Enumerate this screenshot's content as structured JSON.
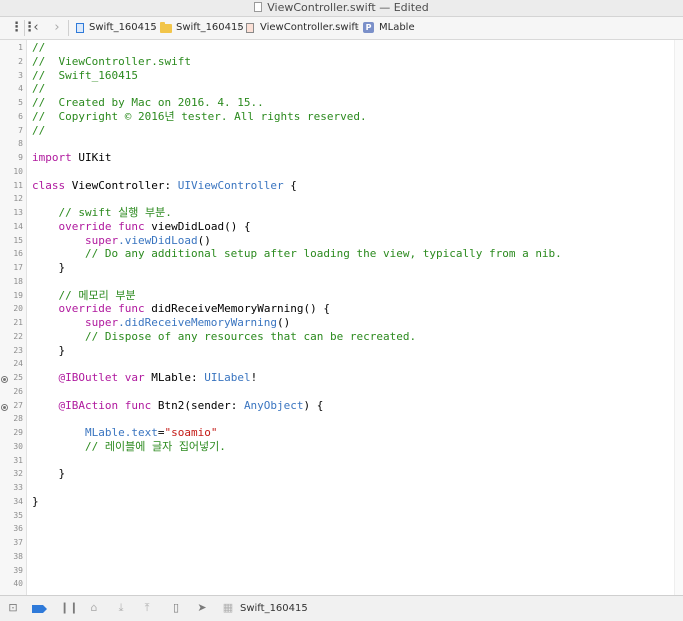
{
  "window": {
    "title": "ViewController.swift — Edited"
  },
  "jumpbar": {
    "crumbs": [
      "Swift_160415",
      "Swift_160415",
      "ViewController.swift",
      "MLable"
    ]
  },
  "gutter": {
    "line_numbers": [
      "1",
      "2",
      "3",
      "4",
      "5",
      "6",
      "7",
      "8",
      "9",
      "10",
      "11",
      "12",
      "13",
      "14",
      "15",
      "16",
      "17",
      "18",
      "19",
      "20",
      "21",
      "22",
      "23",
      "24",
      "25",
      "26",
      "27",
      "28",
      "29",
      "30",
      "31",
      "32",
      "33",
      "34",
      "35",
      "36",
      "37",
      "38",
      "39",
      "40"
    ],
    "outlet_lines": [
      "25",
      "27"
    ]
  },
  "code": {
    "l1": "//",
    "l2": "//  ViewController.swift",
    "l3": "//  Swift_160415",
    "l4": "//",
    "l5": "//  Created by Mac on 2016. 4. 15..",
    "l6": "//  Copyright © 2016년 tester. All rights reserved.",
    "l7": "//",
    "l9_kw": "import",
    "l9_rest": " UIKit",
    "l11_kw": "class",
    "l11_mid": " ViewController: ",
    "l11_type": "UIViewController",
    "l11_end": " {",
    "l13": "    // swift 실행 부분.",
    "l14_kw1": "    override",
    "l14_kw2": " func",
    "l14_rest": " viewDidLoad() {",
    "l15_kw": "        super",
    "l15_call": ".viewDidLoad",
    "l15_end": "()",
    "l16": "        // Do any additional setup after loading the view, typically from a nib.",
    "l17": "    }",
    "l19": "    // 메모리 부분",
    "l20_kw1": "    override",
    "l20_kw2": " func",
    "l20_rest": " didReceiveMemoryWarning() {",
    "l21_kw": "        super",
    "l21_call": ".didReceiveMemoryWarning",
    "l21_end": "()",
    "l22": "        // Dispose of any resources that can be recreated.",
    "l23": "    }",
    "l25_attr": "    @IBOutlet",
    "l25_kw": " var",
    "l25_mid": " MLable: ",
    "l25_type": "UILabel",
    "l25_end": "!",
    "l27_attr": "    @IBAction",
    "l27_kw": " func",
    "l27_mid": " Btn2(sender: ",
    "l27_type": "AnyObject",
    "l27_end": ") {",
    "l29_obj": "        MLable",
    "l29_prop": ".text",
    "l29_eq": "=",
    "l29_str": "\"soamio\"",
    "l30": "        // 레이블에 글자 집어넣기.",
    "l32": "    }",
    "l34": "}"
  },
  "debugbar": {
    "target": "Swift_160415"
  },
  "colors": {
    "comment": "#2b8a1e",
    "keyword": "#b0199e",
    "type": "#3a75c0",
    "string": "#c41a16"
  },
  "icons": [
    "document-icon",
    "back-icon",
    "forward-icon",
    "project-icon",
    "folder-icon",
    "swift-file-icon",
    "property-icon",
    "outlet-connected-icon",
    "hide-debug-icon",
    "breakpoint-icon",
    "pause-icon",
    "step-over-icon",
    "step-in-icon",
    "step-out-icon",
    "view-debugger-icon",
    "location-icon",
    "scheme-icon"
  ]
}
